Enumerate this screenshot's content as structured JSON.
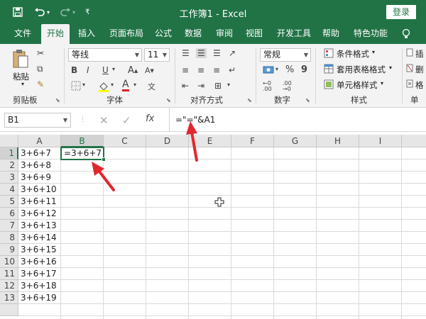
{
  "titlebar": {
    "title": "工作簿1 - Excel",
    "login_label": "登录"
  },
  "tabs": [
    "文件",
    "开始",
    "插入",
    "页面布局",
    "公式",
    "数据",
    "审阅",
    "视图",
    "开发工具",
    "帮助",
    "特色功能"
  ],
  "active_tab": "开始",
  "ribbon": {
    "clipboard": {
      "paste_label": "粘贴",
      "group_label": "剪贴板"
    },
    "font": {
      "font_name": "等线",
      "font_size": "11",
      "bold": "B",
      "italic": "I",
      "underline": "U",
      "font_color_glyph": "A",
      "group_label": "字体"
    },
    "alignment": {
      "group_label": "对齐方式"
    },
    "number": {
      "format": "常规",
      "percent": "%",
      "comma": "9",
      "group_label": "数字"
    },
    "styles": {
      "conditional_format": "条件格式",
      "table_format": "套用表格格式",
      "cell_style": "单元格样式",
      "group_label": "样式"
    },
    "cells": {
      "insert_partial": "插",
      "delete_partial": "删",
      "format_partial": "格",
      "group_label": "单元"
    }
  },
  "formula_bar": {
    "name_box": "B1",
    "cancel_glyph": "✕",
    "enter_glyph": "✓",
    "fx_label": "fx",
    "formula": "=\"=\"&A1"
  },
  "grid": {
    "columns": [
      "A",
      "B",
      "C",
      "D",
      "E",
      "F",
      "G",
      "H",
      "I"
    ],
    "selected_column": "B",
    "rows": [
      "1",
      "2",
      "3",
      "4",
      "5",
      "6",
      "7",
      "8",
      "9",
      "10",
      "11",
      "12",
      "13"
    ],
    "selected_row": "1",
    "col_a_values": [
      "3+6+7",
      "3+6+8",
      "3+6+9",
      "3+6+10",
      "3+6+11",
      "3+6+12",
      "3+6+13",
      "3+6+14",
      "3+6+15",
      "3+6+16",
      "3+6+17",
      "3+6+18",
      "3+6+19"
    ],
    "b1_value": "=3+6+7"
  },
  "colors": {
    "accent": "#217346",
    "annotation_arrow": "#e0282e"
  }
}
